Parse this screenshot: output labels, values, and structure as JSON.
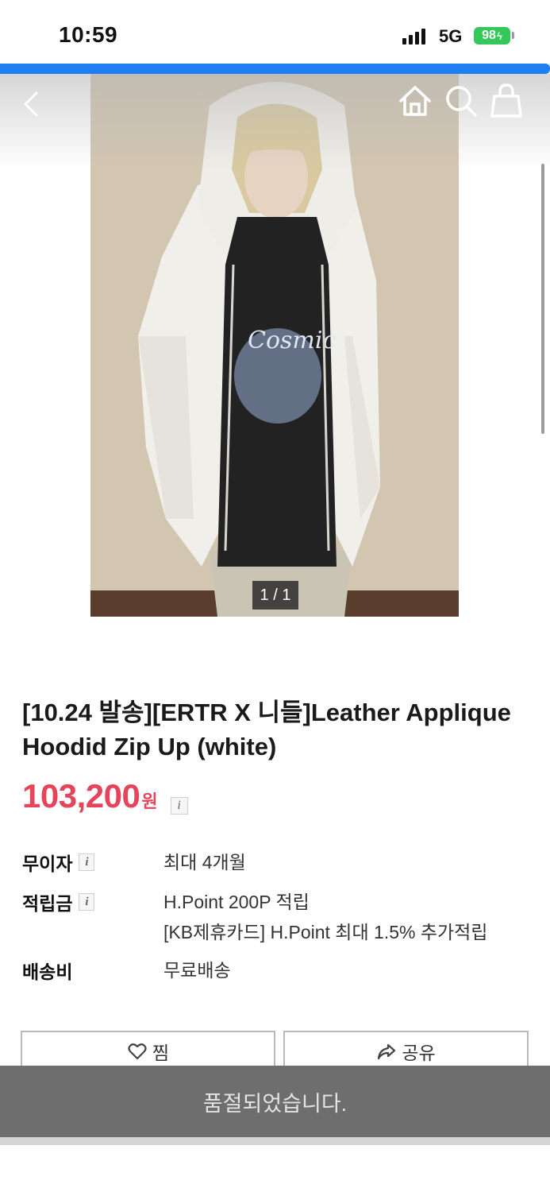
{
  "status_bar": {
    "time": "10:59",
    "network": "5G",
    "battery": "98"
  },
  "page_load_progress": 1.0,
  "colors": {
    "progress": "#1e7ef2",
    "price": "#e5445a",
    "battery": "#34c759",
    "soldout_bar": "#6e6e6e"
  },
  "nav": {
    "icons": [
      "chevron-left-icon",
      "home-icon",
      "search-icon",
      "shopping-bag-icon"
    ]
  },
  "gallery": {
    "indicator": "1 / 1"
  },
  "product": {
    "title": "[10.24 발송][ERTR X 니들]Leather Applique Hoodid Zip Up (white)",
    "price": "103,200",
    "currency": "원",
    "info_icon": "i"
  },
  "info": {
    "installment_label": "무이자",
    "installment_value": "최대 4개월",
    "points_label": "적립금",
    "points_value_1": "H.Point 200P 적립",
    "points_value_2": "[KB제휴카드] H.Point 최대 1.5% 추가적립",
    "shipping_label": "배송비",
    "shipping_value": "무료배송"
  },
  "actions": {
    "wish_label": "찜",
    "share_label": "공유"
  },
  "soldout": {
    "label": "품절되었습니다."
  }
}
